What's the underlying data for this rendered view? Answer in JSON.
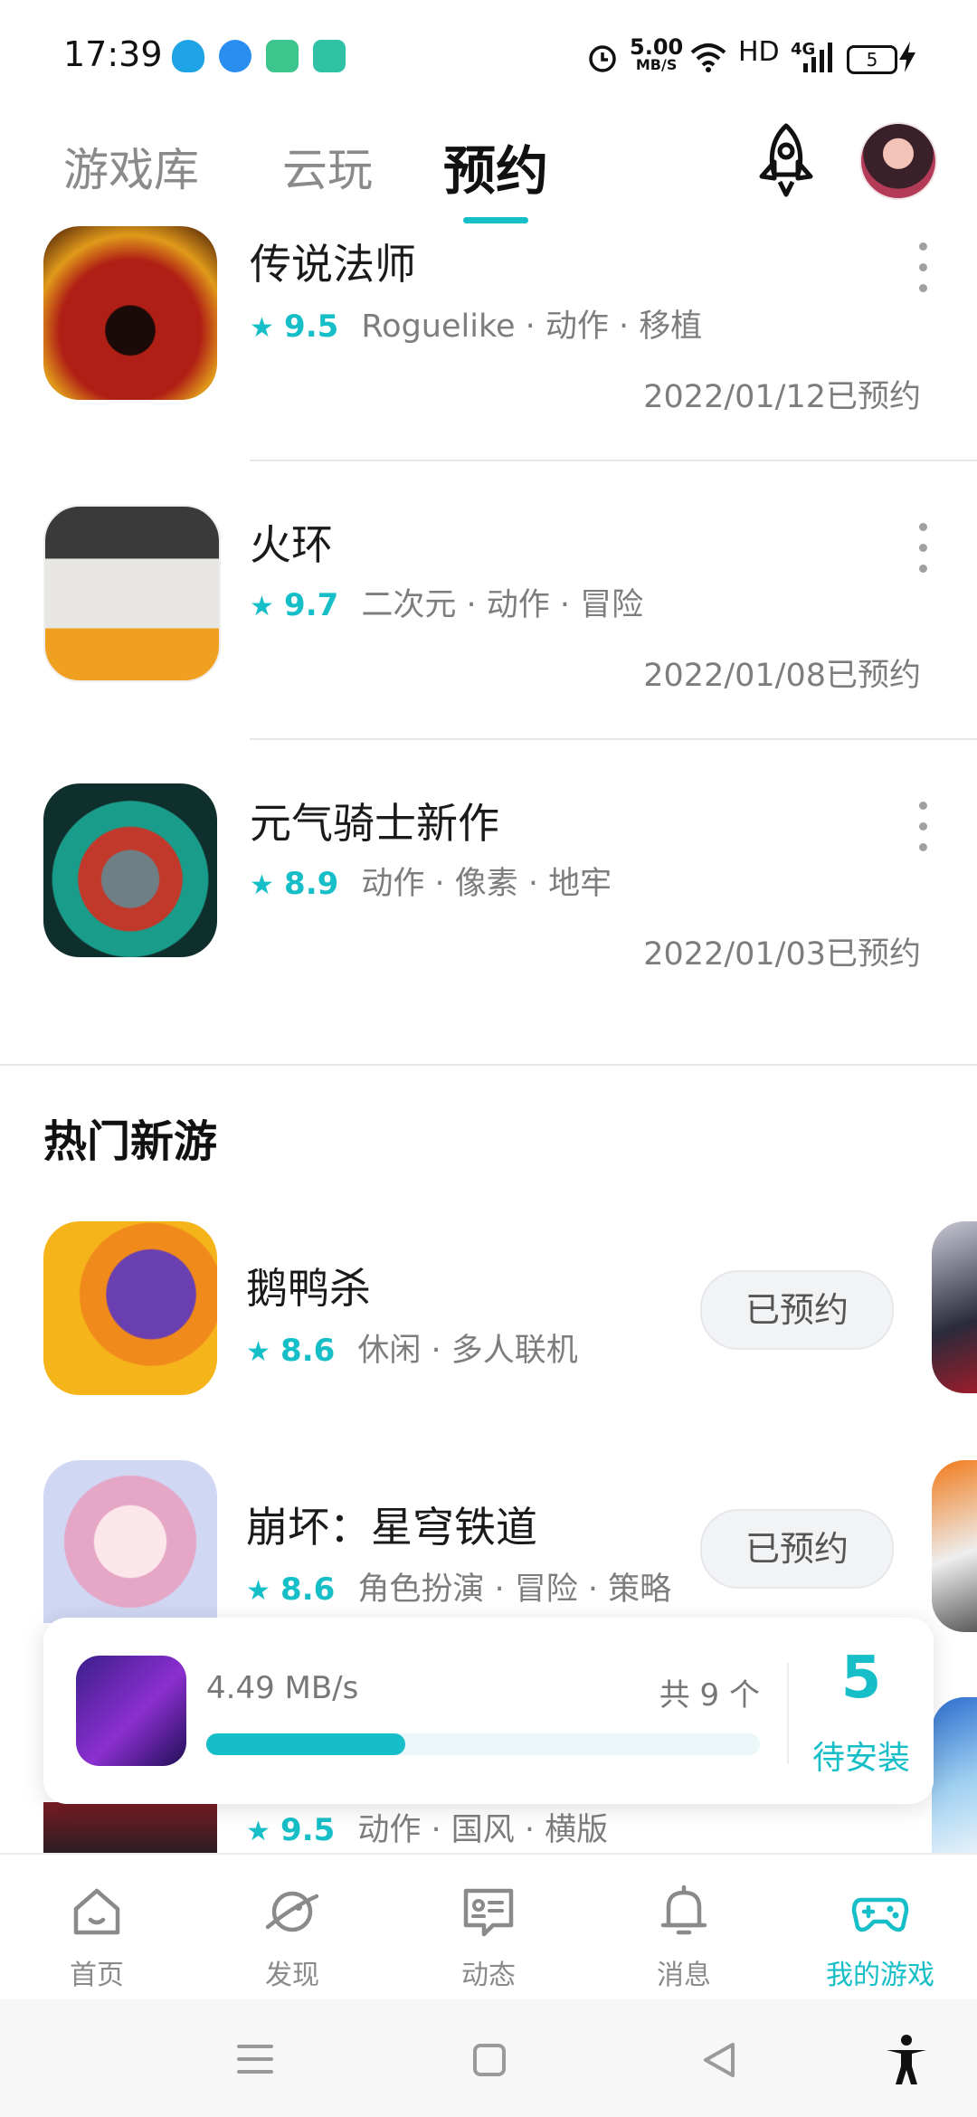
{
  "status_bar": {
    "time": "17:39",
    "speed_value": "5.00",
    "speed_unit": "MB/S",
    "network": "HD",
    "signal": "4G",
    "battery": "5"
  },
  "top_tabs": [
    {
      "label": "游戏库",
      "active": false
    },
    {
      "label": "云玩",
      "active": false
    },
    {
      "label": "预约",
      "active": true
    }
  ],
  "reserved_games": [
    {
      "title": "传说法师",
      "score": "9.5",
      "tags": "Roguelike · 动作 · 移植",
      "date": "2022/01/12已预约"
    },
    {
      "title": "火环",
      "score": "9.7",
      "tags": "二次元 · 动作 · 冒险",
      "date": "2022/01/08已预约"
    },
    {
      "title": "元气骑士新作",
      "score": "8.9",
      "tags": "动作 · 像素 · 地牢",
      "date": "2022/01/03已预约"
    }
  ],
  "hot_section": {
    "title": "热门新游",
    "games": [
      {
        "title": "鹅鸭杀",
        "score": "8.6",
        "tags": "休闲 · 多人联机",
        "button": "已预约"
      },
      {
        "title": "崩坏：星穹铁道",
        "score": "8.6",
        "tags": "角色扮演 · 冒险 · 策略",
        "button": "已预约"
      },
      {
        "title": "",
        "score": "9.5",
        "tags": "动作 · 国风 · 横版",
        "button": ""
      }
    ]
  },
  "download_card": {
    "speed": "4.49 MB/s",
    "total": "共 9 个",
    "progress": 0.36,
    "pending_count": "5",
    "pending_label": "待安装"
  },
  "bottom_nav": [
    {
      "label": "首页",
      "icon": "home-icon",
      "active": false
    },
    {
      "label": "发现",
      "icon": "planet-icon",
      "active": false
    },
    {
      "label": "动态",
      "icon": "chat-icon",
      "active": false
    },
    {
      "label": "消息",
      "icon": "bell-icon",
      "active": false
    },
    {
      "label": "我的游戏",
      "icon": "gamepad-icon",
      "active": true
    }
  ],
  "colors": {
    "accent": "#16bec7"
  }
}
